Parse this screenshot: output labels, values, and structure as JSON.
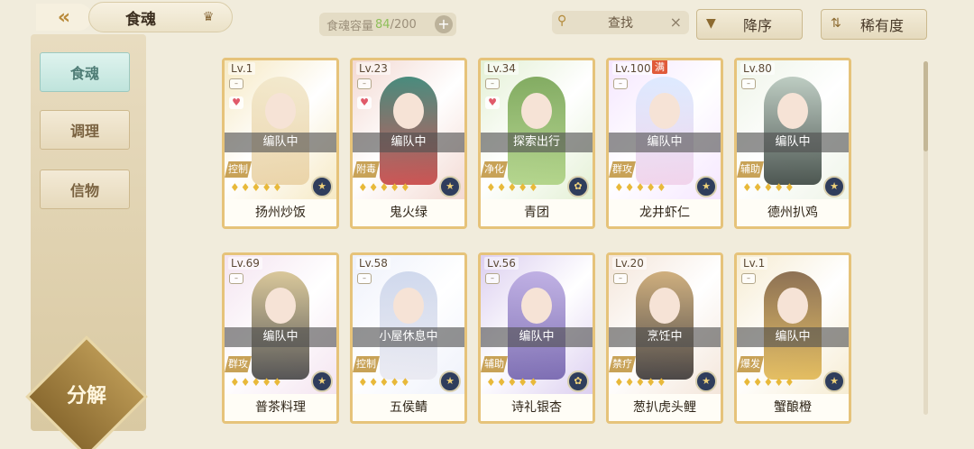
{
  "header": {
    "back_icon": "back-arrow-icon",
    "title": "食魂",
    "title_icon": "crown-icon",
    "capacity_label": "食魂容量",
    "capacity_current": "84",
    "capacity_total": "/200",
    "capacity_add": "+",
    "search_placeholder": "查找",
    "search_clear": "×",
    "sort_order_label": "降序",
    "sort_key_label": "稀有度"
  },
  "sidebar": {
    "items": [
      {
        "label": "食魂",
        "active": true
      },
      {
        "label": "调理",
        "active": false
      },
      {
        "label": "信物",
        "active": false
      }
    ],
    "decompose_label": "分解"
  },
  "colors": {
    "background": "#f1ecdc",
    "gold_frame": "#e6c37a",
    "status_overlay": "#505050"
  },
  "cards": [
    {
      "level": "Lv.1",
      "name": "扬州炒饭",
      "status": "编队中",
      "role": "控制",
      "favorite": true,
      "stars": "♦♦♦♦♦",
      "badge": "★",
      "full": ""
    },
    {
      "level": "Lv.23",
      "name": "鬼火绿",
      "status": "编队中",
      "role": "附毒",
      "favorite": true,
      "stars": "♦♦♦♦♦",
      "badge": "★",
      "full": ""
    },
    {
      "level": "Lv.34",
      "name": "青团",
      "status": "探索出行",
      "role": "净化",
      "favorite": true,
      "stars": "♦♦♦♦♦",
      "badge": "✿",
      "full": ""
    },
    {
      "level": "Lv.100",
      "name": "龙井虾仁",
      "status": "编队中",
      "role": "群攻",
      "favorite": false,
      "stars": "♦♦♦♦♦",
      "badge": "★",
      "full": "满"
    },
    {
      "level": "Lv.80",
      "name": "德州扒鸡",
      "status": "编队中",
      "role": "辅助",
      "favorite": false,
      "stars": "♦♦♦♦♦",
      "badge": "★",
      "full": ""
    },
    {
      "level": "Lv.69",
      "name": "普茶料理",
      "status": "编队中",
      "role": "群攻",
      "favorite": false,
      "stars": "♦♦♦♦♦",
      "badge": "★",
      "full": ""
    },
    {
      "level": "Lv.58",
      "name": "五侯鲭",
      "status": "小屋休息中",
      "role": "控制",
      "favorite": false,
      "stars": "♦♦♦♦♦",
      "badge": "★",
      "full": ""
    },
    {
      "level": "Lv.56",
      "name": "诗礼银杏",
      "status": "编队中",
      "role": "辅助",
      "favorite": false,
      "stars": "♦♦♦♦♦",
      "badge": "✿",
      "full": ""
    },
    {
      "level": "Lv.20",
      "name": "葱扒虎头鲤",
      "status": "烹饪中",
      "role": "禁疗",
      "favorite": false,
      "stars": "♦♦♦♦♦",
      "badge": "★",
      "full": ""
    },
    {
      "level": "Lv.1",
      "name": "蟹酿橙",
      "status": "编队中",
      "role": "爆发",
      "favorite": false,
      "stars": "♦♦♦♦♦",
      "badge": "★",
      "full": ""
    }
  ]
}
